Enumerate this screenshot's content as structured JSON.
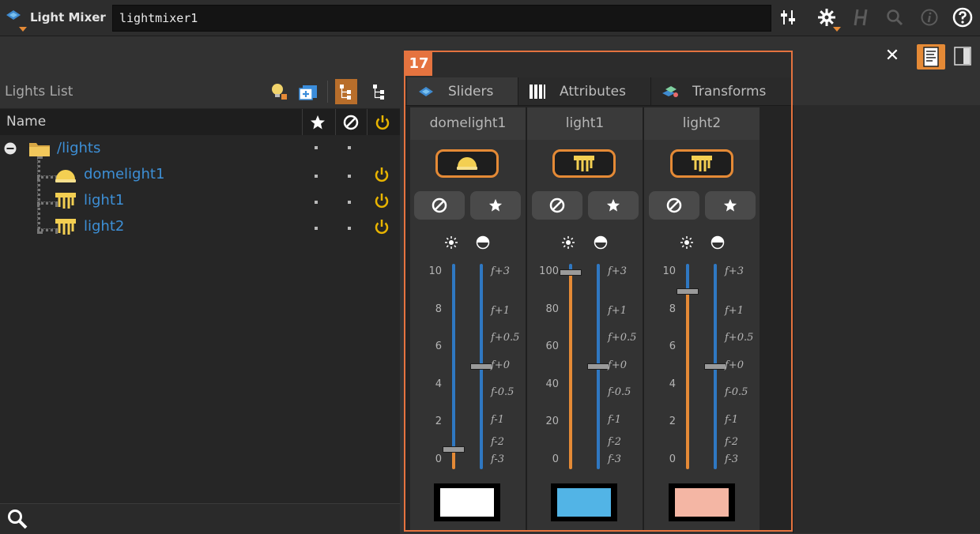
{
  "app": {
    "title": "Light Mixer",
    "node_path": "lightmixer1"
  },
  "panel_badge": "17",
  "lights_list": {
    "title": "Lights List",
    "columns": {
      "name": "Name"
    },
    "tree": [
      {
        "label": "/lights",
        "type": "folder"
      },
      {
        "label": "domelight1",
        "type": "domelight"
      },
      {
        "label": "light1",
        "type": "light"
      },
      {
        "label": "light2",
        "type": "light"
      }
    ]
  },
  "tabs": [
    {
      "label": "Sliders",
      "active": true
    },
    {
      "label": "Attributes",
      "active": false
    },
    {
      "label": "Transforms",
      "active": false
    }
  ],
  "strips": [
    {
      "name": "domelight1",
      "left_ticks": [
        "10",
        "8",
        "6",
        "4",
        "2",
        "0"
      ],
      "intensity": 0.6,
      "intensity_max": 10,
      "exposure": 0,
      "color": "#ffffff"
    },
    {
      "name": "light1",
      "left_ticks": [
        "100",
        "80",
        "60",
        "40",
        "20",
        "0"
      ],
      "intensity": 100,
      "intensity_max": 100,
      "exposure": 0,
      "color": "#52b4e6"
    },
    {
      "name": "light2",
      "left_ticks": [
        "10",
        "8",
        "6",
        "4",
        "2",
        "0"
      ],
      "intensity": 9,
      "intensity_max": 10,
      "exposure": 0,
      "color": "#f4b6a4"
    }
  ],
  "exposure_ticks": [
    "f+3",
    "f+1",
    "f+0.5",
    "f+0",
    "f-0.5",
    "f-1",
    "f-2",
    "f-3"
  ],
  "colors": {
    "accent": "#e58a36",
    "frame": "#e5733f",
    "link": "#3d8fd6",
    "slider": "#2f78c2",
    "power": "#e8b400"
  }
}
